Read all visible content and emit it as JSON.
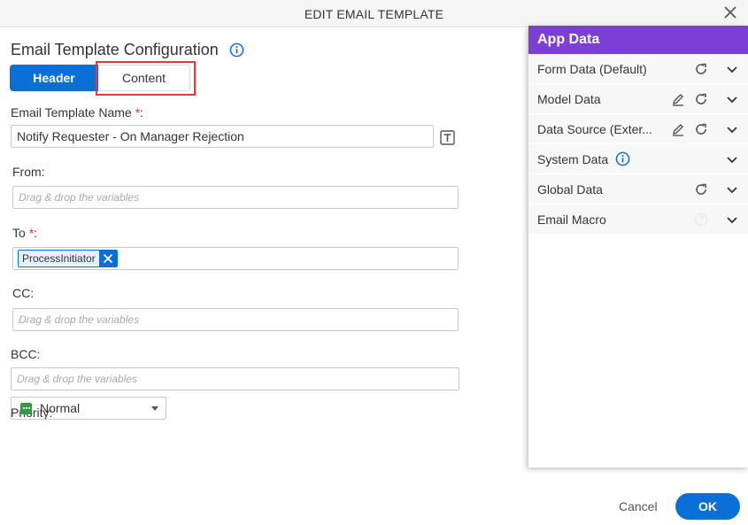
{
  "dialog": {
    "title": "EDIT EMAIL TEMPLATE",
    "close_icon": "close-icon"
  },
  "config": {
    "title": "Email Template Configuration",
    "tabs": [
      {
        "label": "Header",
        "active": true
      },
      {
        "label": "Content",
        "active": false
      }
    ]
  },
  "form": {
    "template_name": {
      "label": "Email Template Name",
      "required": "*",
      "suffix": ":",
      "value": "Notify Requester - On Manager Rejection"
    },
    "from": {
      "label": "From:",
      "placeholder": "Drag & drop the variables"
    },
    "to": {
      "label": "To",
      "required": "*",
      "suffix": ":",
      "chip": "ProcessInitiator"
    },
    "cc": {
      "label": "CC:",
      "placeholder": "Drag & drop the variables"
    },
    "bcc": {
      "label": "BCC:",
      "placeholder": "Drag & drop the variables"
    },
    "priority": {
      "label": "Priority:",
      "value": "Normal",
      "color": "#2e9e3e"
    }
  },
  "app_data": {
    "title": "App Data",
    "items": [
      {
        "label": "Form Data (Default)"
      },
      {
        "label": "Model Data"
      },
      {
        "label": "Data Source (Exter..."
      },
      {
        "label": "System Data"
      },
      {
        "label": "Global Data"
      },
      {
        "label": "Email Macro"
      }
    ]
  },
  "footer": {
    "cancel_label": "Cancel",
    "ok_label": "OK"
  },
  "colors": {
    "primary": "#0a6fd6",
    "panel_header": "#7b3fd6",
    "highlight": "#e53935",
    "required": "#e53935"
  }
}
